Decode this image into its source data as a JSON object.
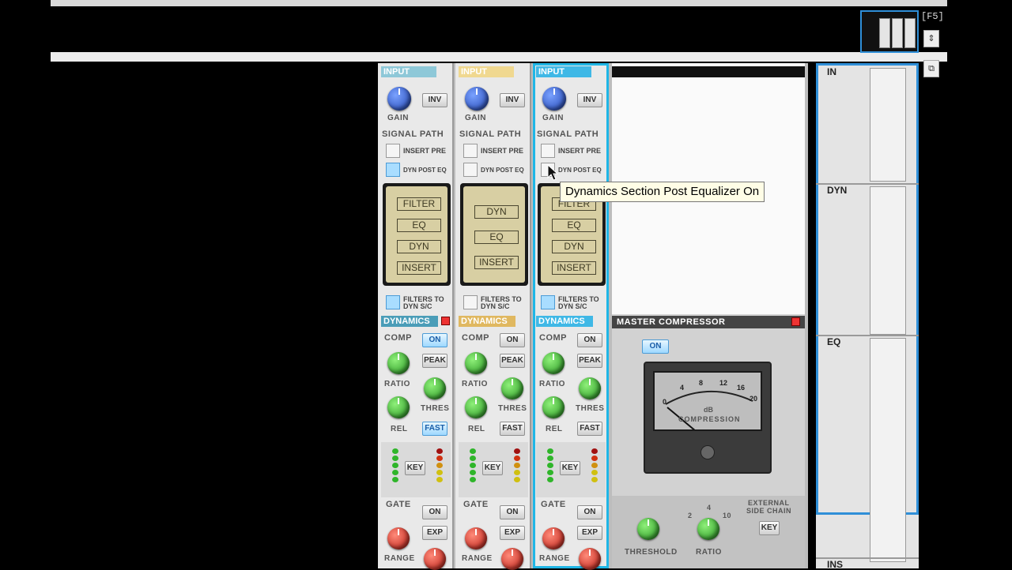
{
  "toolbar": {
    "f5_label": "[F5]"
  },
  "tooltip": {
    "text": "Dynamics Section Post Equalizer On"
  },
  "strips": [
    {
      "input_header": "INPUT",
      "header_color": "#8ec8d8",
      "gain_label": "GAIN",
      "inv_label": "INV",
      "signal_path_label": "SIGNAL PATH",
      "insert_pre_label": "INSERT PRE",
      "dyn_post_eq_label": "DYN POST EQ",
      "dyn_post_eq_on": true,
      "path_order": [
        "FILTER",
        "EQ",
        "DYN",
        "INSERT"
      ],
      "filters_label": "FILTERS TO",
      "filters_label2": "DYN S/C",
      "filters_on": true,
      "dynamics_header": "DYNAMICS",
      "dyn_header_color": "#4a9db8",
      "comp_label": "COMP",
      "on_label": "ON",
      "ratio_label": "RATIO",
      "peak_label": "PEAK",
      "thres_label": "THRES",
      "rel_label": "REL",
      "fast_label": "FAST",
      "fast_on": true,
      "comp_on": true,
      "key_label": "KEY",
      "gate_label": "GATE",
      "gate_on_label": "ON",
      "exp_label": "EXP",
      "range_label": "RANGE"
    },
    {
      "input_header": "INPUT",
      "header_color": "#f0d890",
      "gain_label": "GAIN",
      "inv_label": "INV",
      "signal_path_label": "SIGNAL PATH",
      "insert_pre_label": "INSERT PRE",
      "dyn_post_eq_label": "DYN POST EQ",
      "dyn_post_eq_on": false,
      "path_order": [
        "DYN",
        "EQ",
        "INSERT"
      ],
      "filters_label": "FILTERS TO",
      "filters_label2": "DYN S/C",
      "filters_on": false,
      "dynamics_header": "DYNAMICS",
      "dyn_header_color": "#e0b860",
      "comp_label": "COMP",
      "on_label": "ON",
      "ratio_label": "RATIO",
      "peak_label": "PEAK",
      "thres_label": "THRES",
      "rel_label": "REL",
      "fast_label": "FAST",
      "fast_on": false,
      "comp_on": false,
      "key_label": "KEY",
      "gate_label": "GATE",
      "gate_on_label": "ON",
      "exp_label": "EXP",
      "range_label": "RANGE"
    },
    {
      "input_header": "INPUT",
      "header_color": "#3fb8e6",
      "gain_label": "GAIN",
      "inv_label": "INV",
      "signal_path_label": "SIGNAL PATH",
      "insert_pre_label": "INSERT PRE",
      "dyn_post_eq_label": "DYN POST EQ",
      "dyn_post_eq_on": false,
      "path_order": [
        "FILTER",
        "EQ",
        "DYN",
        "INSERT"
      ],
      "filters_label": "FILTERS TO",
      "filters_label2": "DYN S/C",
      "filters_on": true,
      "dynamics_header": "DYNAMICS",
      "dyn_header_color": "#3fb8e6",
      "comp_label": "COMP",
      "on_label": "ON",
      "ratio_label": "RATIO",
      "peak_label": "PEAK",
      "thres_label": "THRES",
      "rel_label": "REL",
      "fast_label": "FAST",
      "fast_on": false,
      "comp_on": false,
      "key_label": "KEY",
      "gate_label": "GATE",
      "gate_on_label": "ON",
      "exp_label": "EXP",
      "range_label": "RANGE"
    }
  ],
  "master_compressor": {
    "title": "MASTER COMPRESSOR",
    "on_label": "ON",
    "meter_ticks": [
      "0",
      "4",
      "8",
      "12",
      "16",
      "20"
    ],
    "meter_db": "dB",
    "meter_label": "COMPRESSION",
    "threshold_label": "THRESHOLD",
    "ratio_label": "RATIO",
    "ratio_marks": [
      "2",
      "4",
      "10"
    ],
    "ext_sc_label": "EXTERNAL",
    "ext_sc_label2": "SIDE CHAIN",
    "key_label": "KEY"
  },
  "navigator": {
    "sections": [
      "IN",
      "DYN",
      "EQ",
      "INS"
    ]
  }
}
